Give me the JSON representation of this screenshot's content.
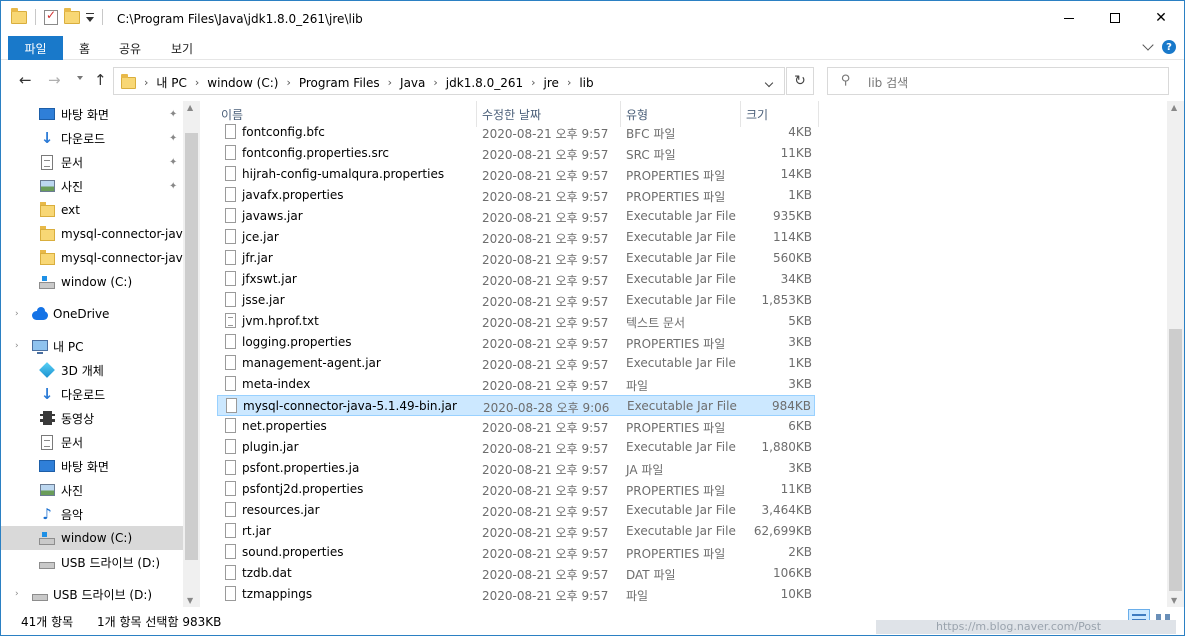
{
  "title_path": "C:\\Program Files\\Java\\jdk1.8.0_261\\jre\\lib",
  "ribbon": {
    "file_tab": "파일",
    "tabs": [
      "홈",
      "공유",
      "보기"
    ],
    "help": "?"
  },
  "address": {
    "crumbs": [
      "내 PC",
      "window (C:)",
      "Program Files",
      "Java",
      "jdk1.8.0_261",
      "jre",
      "lib"
    ],
    "separator": "›",
    "refresh_glyph": "↻"
  },
  "search": {
    "placeholder": "lib 검색"
  },
  "nav": {
    "items": [
      {
        "label": "바탕 화면",
        "icon": "desktop-icon",
        "pinned": true
      },
      {
        "label": "다운로드",
        "icon": "download-icon",
        "pinned": true
      },
      {
        "label": "문서",
        "icon": "document-icon",
        "pinned": true
      },
      {
        "label": "사진",
        "icon": "pictures-icon",
        "pinned": true
      },
      {
        "label": "ext",
        "icon": "folder-icon",
        "pinned": false
      },
      {
        "label": "mysql-connector-java-",
        "icon": "folder-icon",
        "pinned": false
      },
      {
        "label": "mysql-connector-java-",
        "icon": "folder-icon",
        "pinned": false
      },
      {
        "label": "window (C:)",
        "icon": "drive-icon",
        "pinned": false
      },
      {
        "label": "OneDrive",
        "icon": "onedrive-icon",
        "pinned": false
      },
      {
        "label": "내 PC",
        "icon": "pc-icon",
        "pinned": false
      },
      {
        "label": "3D 개체",
        "icon": "3d-objects-icon",
        "pinned": false
      },
      {
        "label": "다운로드",
        "icon": "download-icon",
        "pinned": false
      },
      {
        "label": "동영상",
        "icon": "video-icon",
        "pinned": false
      },
      {
        "label": "문서",
        "icon": "document-icon",
        "pinned": false
      },
      {
        "label": "바탕 화면",
        "icon": "desktop-icon",
        "pinned": false
      },
      {
        "label": "사진",
        "icon": "pictures-icon",
        "pinned": false
      },
      {
        "label": "음악",
        "icon": "music-icon",
        "pinned": false
      },
      {
        "label": "window (C:)",
        "icon": "drive-icon",
        "pinned": false,
        "selected": true
      },
      {
        "label": "USB 드라이브 (D:)",
        "icon": "usb-drive-icon",
        "pinned": false
      },
      {
        "label": "USB 드라이브 (D:)",
        "icon": "usb-drive-icon",
        "pinned": false
      }
    ]
  },
  "columns": {
    "name": "이름",
    "date": "수정한 날짜",
    "type": "유형",
    "size": "크기"
  },
  "files": [
    {
      "name": "fontconfig.bfc",
      "date": "2020-08-21 오후 9:57",
      "type": "BFC 파일",
      "size": "4KB"
    },
    {
      "name": "fontconfig.properties.src",
      "date": "2020-08-21 오후 9:57",
      "type": "SRC 파일",
      "size": "11KB"
    },
    {
      "name": "hijrah-config-umalqura.properties",
      "date": "2020-08-21 오후 9:57",
      "type": "PROPERTIES 파일",
      "size": "14KB"
    },
    {
      "name": "javafx.properties",
      "date": "2020-08-21 오후 9:57",
      "type": "PROPERTIES 파일",
      "size": "1KB"
    },
    {
      "name": "javaws.jar",
      "date": "2020-08-21 오후 9:57",
      "type": "Executable Jar File",
      "size": "935KB"
    },
    {
      "name": "jce.jar",
      "date": "2020-08-21 오후 9:57",
      "type": "Executable Jar File",
      "size": "114KB"
    },
    {
      "name": "jfr.jar",
      "date": "2020-08-21 오후 9:57",
      "type": "Executable Jar File",
      "size": "560KB"
    },
    {
      "name": "jfxswt.jar",
      "date": "2020-08-21 오후 9:57",
      "type": "Executable Jar File",
      "size": "34KB"
    },
    {
      "name": "jsse.jar",
      "date": "2020-08-21 오후 9:57",
      "type": "Executable Jar File",
      "size": "1,853KB"
    },
    {
      "name": "jvm.hprof.txt",
      "date": "2020-08-21 오후 9:57",
      "type": "텍스트 문서",
      "size": "5KB"
    },
    {
      "name": "logging.properties",
      "date": "2020-08-21 오후 9:57",
      "type": "PROPERTIES 파일",
      "size": "3KB"
    },
    {
      "name": "management-agent.jar",
      "date": "2020-08-21 오후 9:57",
      "type": "Executable Jar File",
      "size": "1KB"
    },
    {
      "name": "meta-index",
      "date": "2020-08-21 오후 9:57",
      "type": "파일",
      "size": "3KB"
    },
    {
      "name": "mysql-connector-java-5.1.49-bin.jar",
      "date": "2020-08-28 오후 9:06",
      "type": "Executable Jar File",
      "size": "984KB",
      "selected": true
    },
    {
      "name": "net.properties",
      "date": "2020-08-21 오후 9:57",
      "type": "PROPERTIES 파일",
      "size": "6KB"
    },
    {
      "name": "plugin.jar",
      "date": "2020-08-21 오후 9:57",
      "type": "Executable Jar File",
      "size": "1,880KB"
    },
    {
      "name": "psfont.properties.ja",
      "date": "2020-08-21 오후 9:57",
      "type": "JA 파일",
      "size": "3KB"
    },
    {
      "name": "psfontj2d.properties",
      "date": "2020-08-21 오후 9:57",
      "type": "PROPERTIES 파일",
      "size": "11KB"
    },
    {
      "name": "resources.jar",
      "date": "2020-08-21 오후 9:57",
      "type": "Executable Jar File",
      "size": "3,464KB"
    },
    {
      "name": "rt.jar",
      "date": "2020-08-21 오후 9:57",
      "type": "Executable Jar File",
      "size": "62,699KB"
    },
    {
      "name": "sound.properties",
      "date": "2020-08-21 오후 9:57",
      "type": "PROPERTIES 파일",
      "size": "2KB"
    },
    {
      "name": "tzdb.dat",
      "date": "2020-08-21 오후 9:57",
      "type": "DAT 파일",
      "size": "106KB"
    },
    {
      "name": "tzmappings",
      "date": "2020-08-21 오후 9:57",
      "type": "파일",
      "size": "10KB"
    }
  ],
  "status": {
    "count": "41개 항목",
    "selection": "1개 항목 선택함 983KB"
  },
  "watermark": "https://m.blog.naver.com/Post",
  "colors": {
    "accent": "#1979ca",
    "selection": "#cce8ff",
    "selection_border": "#99d1ff"
  }
}
